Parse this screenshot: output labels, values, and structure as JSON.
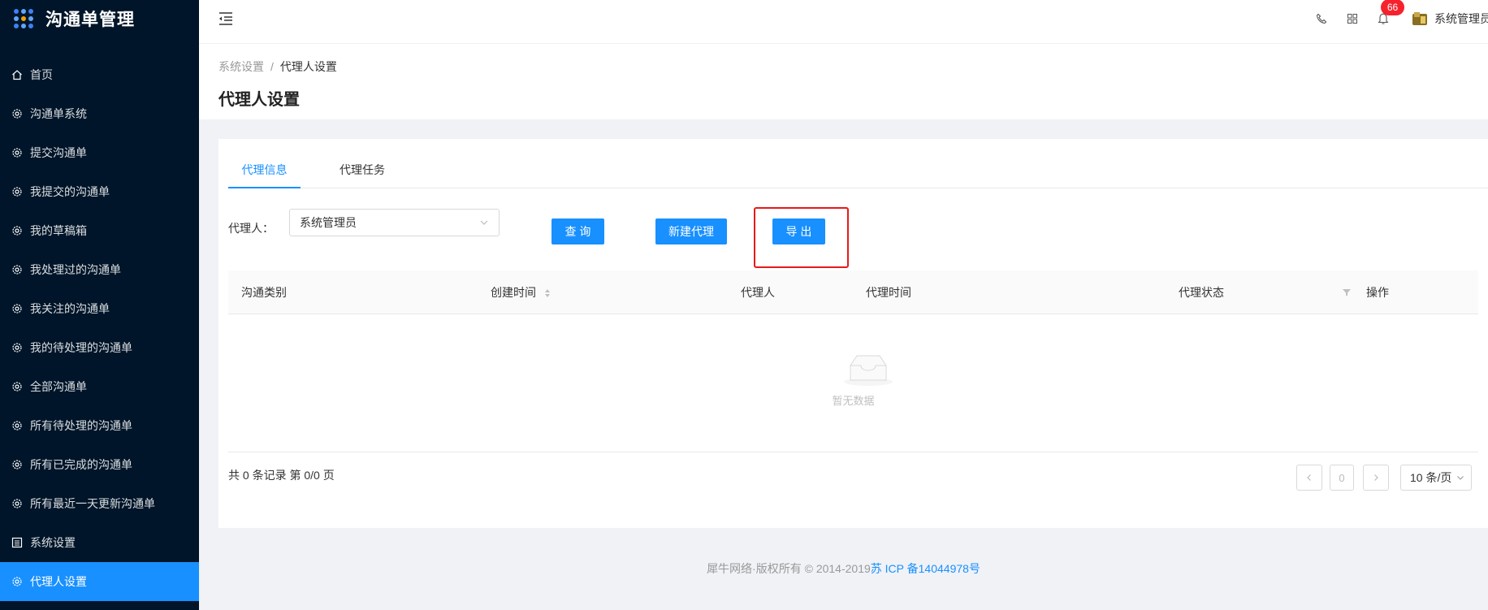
{
  "app": {
    "title": "沟通单管理"
  },
  "sidebar": {
    "items": [
      {
        "label": "首页",
        "icon": "home-icon"
      },
      {
        "label": "沟通单系统",
        "icon": "gear-icon"
      },
      {
        "label": "提交沟通单",
        "icon": "gear-icon"
      },
      {
        "label": "我提交的沟通单",
        "icon": "gear-icon"
      },
      {
        "label": "我的草稿箱",
        "icon": "gear-icon"
      },
      {
        "label": "我处理过的沟通单",
        "icon": "gear-icon"
      },
      {
        "label": "我关注的沟通单",
        "icon": "gear-icon"
      },
      {
        "label": "我的待处理的沟通单",
        "icon": "gear-icon"
      },
      {
        "label": "全部沟通单",
        "icon": "gear-icon"
      },
      {
        "label": "所有待处理的沟通单",
        "icon": "gear-icon"
      },
      {
        "label": "所有已完成的沟通单",
        "icon": "gear-icon"
      },
      {
        "label": "所有最近一天更新沟通单",
        "icon": "gear-icon"
      },
      {
        "label": "系统设置",
        "icon": "list-icon"
      },
      {
        "label": "代理人设置",
        "icon": "gear-icon",
        "active": true
      }
    ]
  },
  "header": {
    "notification_count": "66",
    "user_name": "系统管理员"
  },
  "breadcrumb": {
    "parent": "系统设置",
    "separator": "/",
    "current": "代理人设置"
  },
  "page": {
    "title": "代理人设置"
  },
  "tabs": [
    {
      "label": "代理信息",
      "active": true
    },
    {
      "label": "代理任务",
      "active": false
    }
  ],
  "form": {
    "agent_label": "代理人：",
    "agent_value": "系统管理员",
    "query_label": "查 询",
    "new_label": "新建代理",
    "export_label": "导 出"
  },
  "table": {
    "columns": [
      "沟通类别",
      "创建时间",
      "代理人",
      "代理时间",
      "代理状态",
      "操作"
    ],
    "empty_text": "暂无数据"
  },
  "pagination": {
    "total_text": "共 0 条记录 第 0/0 页",
    "current_page": "0",
    "page_size": "10 条/页"
  },
  "footer": {
    "text": "犀牛网络·版权所有 © 2014-2019",
    "icp": "苏 ICP 备14044978号"
  },
  "colors": {
    "sidebar_bg": "#001529",
    "primary": "#1890ff",
    "highlight": "#e81919",
    "badge": "#f5222d"
  }
}
